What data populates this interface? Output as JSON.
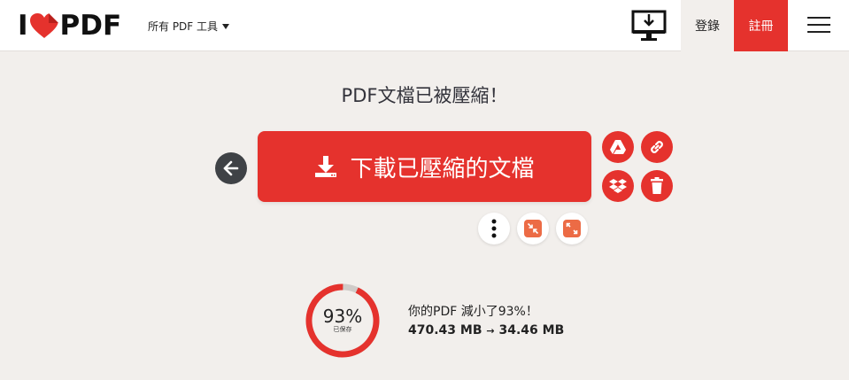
{
  "header": {
    "logo": {
      "left": "I",
      "right": "PDF"
    },
    "tools_menu_label": "所有 PDF 工具",
    "login_label": "登錄",
    "signup_label": "註冊"
  },
  "result": {
    "title": "PDF文檔已被壓縮！",
    "download_label": "下載已壓縮的文檔"
  },
  "stats": {
    "saved_fraction": 0.93,
    "percent_label": "93%",
    "percent_caption": "已保存",
    "summary_line": "你的PDF 減小了93%！",
    "size_before": "470.43 MB",
    "size_after": "34.46 MB"
  },
  "colors": {
    "brand_red": "#e5322d",
    "tile_orange": "#ec6b45",
    "background": "#f2efec",
    "dark_button": "#3f4246"
  },
  "icons": [
    "heart-logo-icon",
    "caret-down-icon",
    "desktop-download-icon",
    "hamburger-menu-icon",
    "arrow-left-icon",
    "download-icon",
    "google-drive-icon",
    "link-icon",
    "dropbox-icon",
    "trash-icon",
    "more-vertical-icon",
    "compress-icon",
    "expand-icon"
  ]
}
